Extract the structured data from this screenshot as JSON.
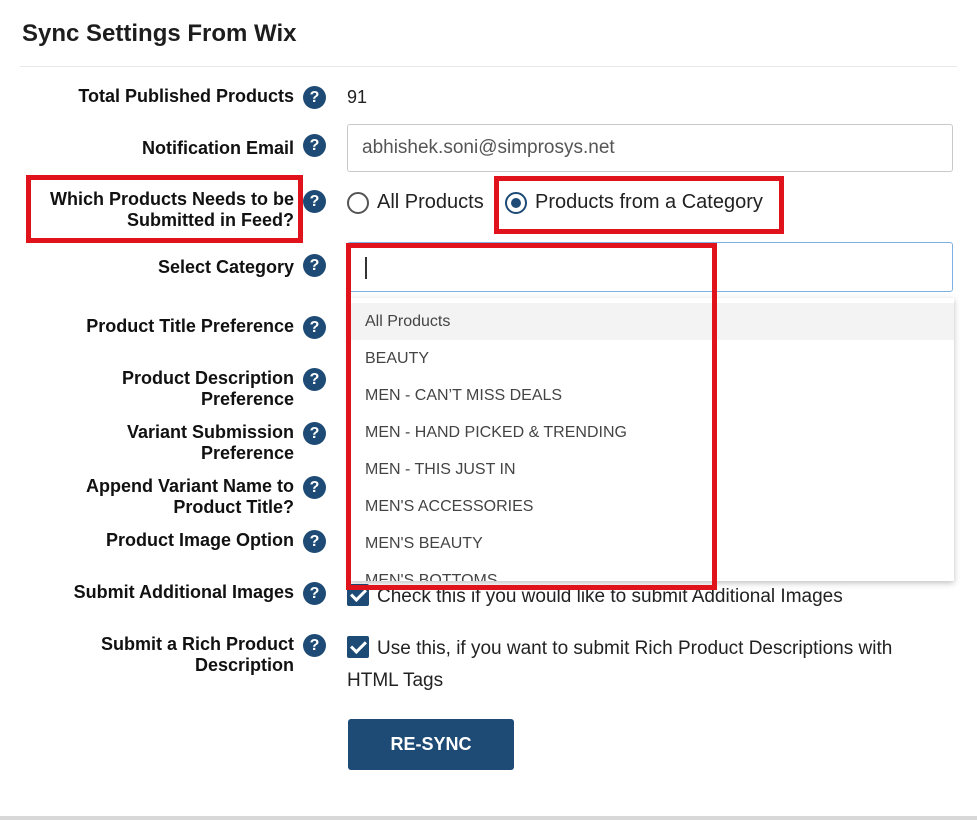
{
  "panel": {
    "title": "Sync Settings From Wix"
  },
  "fields": {
    "total_published": {
      "label": "Total Published Products",
      "value": "91"
    },
    "notification_email": {
      "label": "Notification Email",
      "value": "abhishek.soni@simprosys.net"
    },
    "which_products": {
      "label_line1": "Which Products Needs to be",
      "label_line2": "Submitted in Feed?",
      "options": [
        "All Products",
        "Products from a Category"
      ],
      "selected": "Products from a Category"
    },
    "select_category": {
      "label": "Select Category",
      "value": "",
      "dropdown_items": [
        "All Products",
        "BEAUTY",
        "MEN - CAN’T MISS DEALS",
        "MEN - HAND PICKED & TRENDING",
        "MEN - THIS JUST IN",
        "MEN'S ACCESSORIES",
        "MEN'S BEAUTY",
        "MEN'S BOTTOMS"
      ]
    },
    "title_pref": {
      "label": "Product Title Preference"
    },
    "desc_pref": {
      "label_line1": "Product Description",
      "label_line2": "Preference"
    },
    "variant_pref": {
      "label_line1": "Variant Submission",
      "label_line2": "Preference"
    },
    "append_variant": {
      "label_line1": "Append Variant Name to",
      "label_line2": "Product Title?"
    },
    "image_option": {
      "label": "Product Image Option"
    },
    "additional_images": {
      "label": "Submit Additional Images",
      "checkbox_text": "Check this if you would like to submit Additional Images",
      "checked": true
    },
    "rich_description": {
      "label_line1": "Submit a Rich Product",
      "label_line2": "Description",
      "checkbox_text_line1": "Use this, if you want to submit Rich Product Descriptions with",
      "checkbox_text_line2": "HTML Tags",
      "checked": true
    }
  },
  "help_icon": "question-mark-icon",
  "resync_button": {
    "label": "RE-SYNC"
  },
  "colors": {
    "accent": "#1e4b75",
    "highlight": "#e0121b",
    "focus_border": "#7cb1e4"
  }
}
